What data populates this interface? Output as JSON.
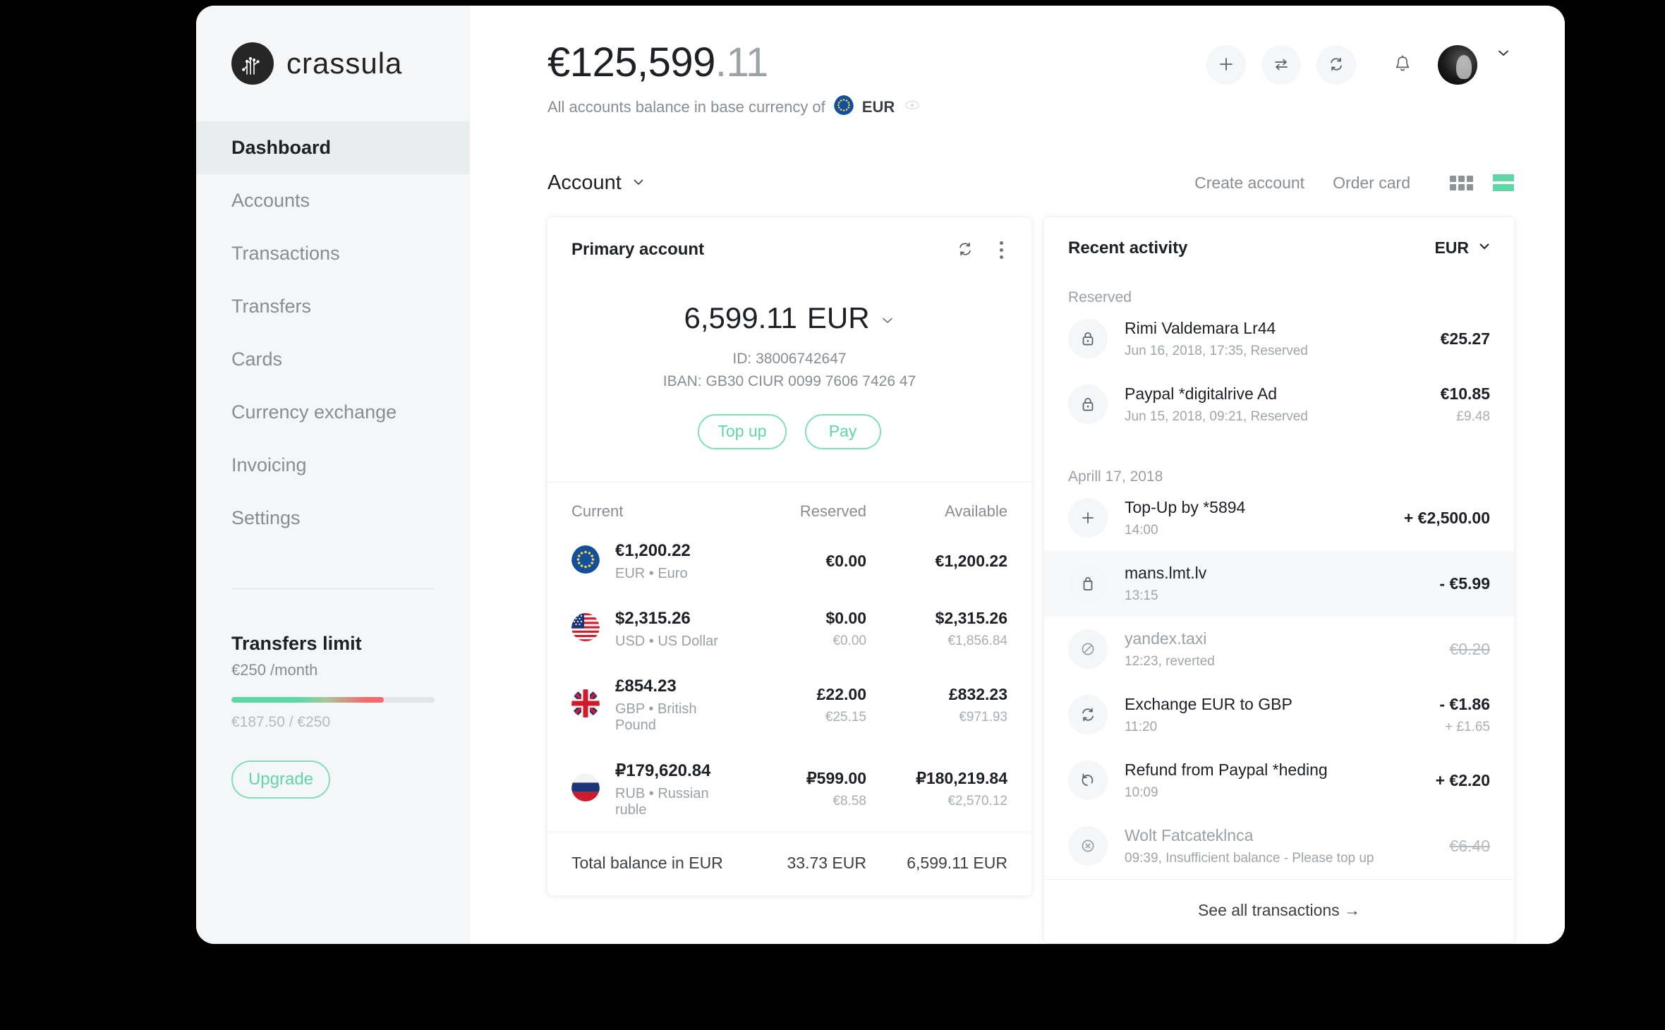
{
  "brand": {
    "name": "crassula"
  },
  "sidebar": {
    "items": [
      {
        "label": "Dashboard",
        "active": true
      },
      {
        "label": "Accounts",
        "active": false
      },
      {
        "label": "Transactions",
        "active": false
      },
      {
        "label": "Transfers",
        "active": false
      },
      {
        "label": "Cards",
        "active": false
      },
      {
        "label": "Currency exchange",
        "active": false
      },
      {
        "label": "Invoicing",
        "active": false
      },
      {
        "label": "Settings",
        "active": false
      }
    ],
    "limit": {
      "title": "Transfers limit",
      "subtitle": "€250 /month",
      "used_label": "€187.50 / €250",
      "progress_percent": 75,
      "upgrade_label": "Upgrade"
    }
  },
  "header": {
    "balance_whole": "€125,599",
    "balance_cents": ".11",
    "subtitle": "All accounts balance in base currency of",
    "base_currency": "EUR",
    "icons": {
      "add": "plus-icon",
      "transfer": "transfer-arrows-icon",
      "exchange": "exchange-icon",
      "notifications": "bell-icon",
      "profile": "avatar",
      "profile_menu": "chevron-down-icon",
      "visibility": "eye-icon"
    }
  },
  "toolbar": {
    "account_label": "Account",
    "create_account_label": "Create account",
    "order_card_label": "Order card",
    "view_grid": "grid-view-icon",
    "view_list": "list-view-icon",
    "active_view": "list"
  },
  "primary_account": {
    "title": "Primary account",
    "balance_amount": "6,599.11",
    "balance_currency": "EUR",
    "id_label": "ID: 38006742647",
    "iban_label": "IBAN: GB30 CIUR 0099 7606 7426 47",
    "topup_label": "Top up",
    "pay_label": "Pay",
    "columns": {
      "current": "Current",
      "reserved": "Reserved",
      "available": "Available"
    },
    "rows": [
      {
        "flag": "eu-flag",
        "amount": "€1,200.22",
        "name": "EUR • Euro",
        "reserved": "€0.00",
        "reserved_sub": "",
        "available": "€1,200.22",
        "available_sub": ""
      },
      {
        "flag": "us-flag",
        "amount": "$2,315.26",
        "name": "USD • US Dollar",
        "reserved": "$0.00",
        "reserved_sub": "€0.00",
        "available": "$2,315.26",
        "available_sub": "€1,856.84"
      },
      {
        "flag": "gb-flag",
        "amount": "£854.23",
        "name": "GBP • British Pound",
        "reserved": "£22.00",
        "reserved_sub": "€25.15",
        "available": "£832.23",
        "available_sub": "€971.93"
      },
      {
        "flag": "ru-flag",
        "amount": "₽179,620.84",
        "name": "RUB • Russian ruble",
        "reserved": "₽599.00",
        "reserved_sub": "€8.58",
        "available": "₽180,219.84",
        "available_sub": "€2,570.12"
      }
    ],
    "total": {
      "label": "Total balance in EUR",
      "reserved": "33.73 EUR",
      "available": "6,599.11 EUR"
    }
  },
  "recent_activity": {
    "title": "Recent activity",
    "currency_filter": "EUR",
    "groups": [
      {
        "label": "Reserved",
        "items": [
          {
            "icon": "lock-icon",
            "title": "Rimi Valdemara Lr44",
            "meta": "Jun 16, 2018, 17:35, Reserved",
            "amount": "€25.27",
            "amount_sub": "",
            "style": "normal",
            "highlighted": false
          },
          {
            "icon": "lock-icon",
            "title": "Paypal *digitalrive Ad",
            "meta": "Jun 15, 2018, 09:21, Reserved",
            "amount": "€10.85",
            "amount_sub": "£9.48",
            "style": "normal",
            "highlighted": false
          }
        ]
      },
      {
        "label": "Aprill 17, 2018",
        "items": [
          {
            "icon": "plus-icon",
            "title": "Top-Up by *5894",
            "meta": "14:00",
            "amount": "+ €2,500.00",
            "amount_sub": "",
            "style": "normal",
            "highlighted": false
          },
          {
            "icon": "bag-icon",
            "title": "mans.lmt.lv",
            "meta": "13:15",
            "amount": "- €5.99",
            "amount_sub": "",
            "style": "normal",
            "highlighted": true
          },
          {
            "icon": "blocked-icon",
            "title": "yandex.taxi",
            "meta": "12:23, reverted",
            "amount": "€0.20",
            "amount_sub": "",
            "style": "strike",
            "highlighted": false
          },
          {
            "icon": "exchange-icon",
            "title": "Exchange EUR to GBP",
            "meta": "11:20",
            "amount": "- €1.86",
            "amount_sub": "+ £1.65",
            "style": "normal",
            "highlighted": false
          },
          {
            "icon": "refund-icon",
            "title": "Refund from Paypal *heding",
            "meta": "10:09",
            "amount": "+ €2.20",
            "amount_sub": "",
            "style": "normal",
            "highlighted": false
          },
          {
            "icon": "error-circle-icon",
            "title": "Wolt Fatcateklnca",
            "meta": "09:39, Insufficient balance - Please top up",
            "amount": "€6.40",
            "amount_sub": "",
            "style": "strike",
            "highlighted": false
          }
        ]
      }
    ],
    "see_all_label": "See all transactions",
    "see_all_arrow": "→"
  },
  "colors": {
    "accent_green": "#5fd6a8",
    "sidebar_bg": "#f4f6f7",
    "text_dark": "#1d2024",
    "text_muted": "#878d92"
  }
}
